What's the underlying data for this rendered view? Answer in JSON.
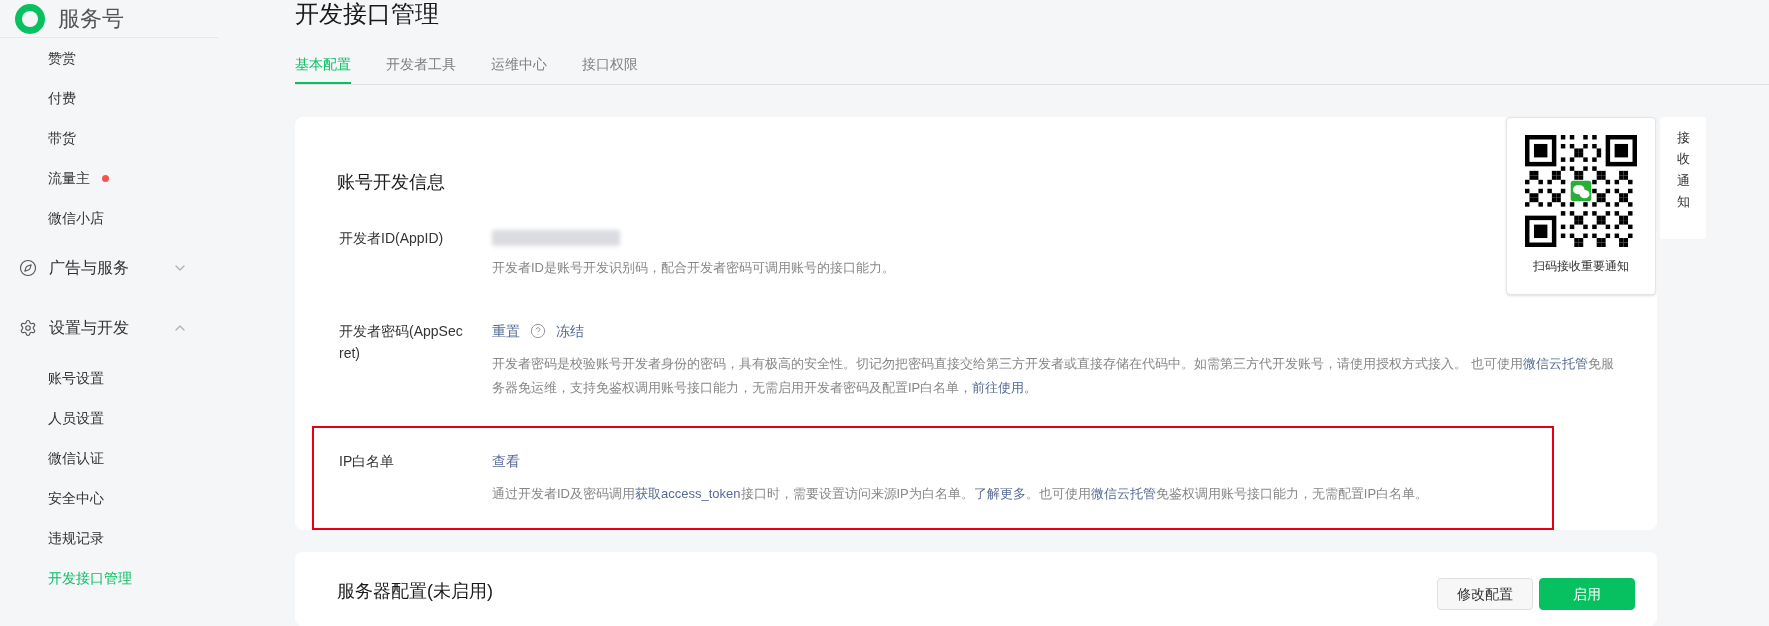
{
  "sidebar": {
    "brand": "服务号",
    "items": [
      {
        "kind": "item",
        "label": "赞赏",
        "selected": false,
        "dot": false
      },
      {
        "kind": "item",
        "label": "付费",
        "selected": false,
        "dot": false
      },
      {
        "kind": "item",
        "label": "带货",
        "selected": false,
        "dot": false
      },
      {
        "kind": "item",
        "label": "流量主",
        "selected": false,
        "dot": true
      },
      {
        "kind": "item",
        "label": "微信小店",
        "selected": false,
        "dot": false
      },
      {
        "kind": "group",
        "label": "广告与服务",
        "expanded": false
      },
      {
        "kind": "group",
        "label": "设置与开发",
        "expanded": true,
        "children": [
          {
            "label": "账号设置",
            "selected": false
          },
          {
            "label": "人员设置",
            "selected": false
          },
          {
            "label": "微信认证",
            "selected": false
          },
          {
            "label": "安全中心",
            "selected": false
          },
          {
            "label": "违规记录",
            "selected": false
          },
          {
            "label": "开发接口管理",
            "selected": true
          }
        ]
      }
    ]
  },
  "page_title": "开发接口管理",
  "tabs": [
    {
      "label": "基本配置",
      "selected": true
    },
    {
      "label": "开发者工具",
      "selected": false
    },
    {
      "label": "运维中心",
      "selected": false
    },
    {
      "label": "接口权限",
      "selected": false
    }
  ],
  "account_card": {
    "title": "账号开发信息",
    "rows": [
      {
        "label": "开发者ID(AppID)",
        "highlighted": false,
        "value_blurred": true,
        "actions": [],
        "description": [
          {
            "text": "开发者ID是账号开发识别码，配合开发者密码可调用账号的接口能力。",
            "link": false
          }
        ]
      },
      {
        "label": "开发者密码(AppSecret)",
        "highlighted": false,
        "value_blurred": false,
        "actions": [
          {
            "kind": "link",
            "label": "重置"
          },
          {
            "kind": "help"
          },
          {
            "kind": "link",
            "label": "冻结"
          }
        ],
        "description": [
          {
            "text": "开发者密码是校验账号开发者身份的密码，具有极高的安全性。切记勿把密码直接交给第三方开发者或直接存储在代码中。如需第三方代开发账号，请使用授权方式接入。 也可使用",
            "link": false
          },
          {
            "text": "微信云托管",
            "link": true
          },
          {
            "text": "免服务器免运维，支持免鉴权调用账号接口能力，无需启用开发者密码及配置IP白名单，",
            "link": false
          },
          {
            "text": "前往使用。",
            "link": true
          }
        ]
      },
      {
        "label": "IP白名单",
        "highlighted": true,
        "value_blurred": false,
        "actions": [
          {
            "kind": "link",
            "label": "查看"
          }
        ],
        "description": [
          {
            "text": "通过开发者ID及密码调用",
            "link": false
          },
          {
            "text": "获取access_token",
            "link": true
          },
          {
            "text": "接口时，需要设置访问来源IP为白名单。",
            "link": false
          },
          {
            "text": "了解更多",
            "link": true
          },
          {
            "text": "。也可使用",
            "link": false
          },
          {
            "text": "微信云托管",
            "link": true
          },
          {
            "text": "免鉴权调用账号接口能力，无需配置IP白名单。",
            "link": false
          }
        ]
      }
    ]
  },
  "qr_popup": {
    "caption": "扫码接收重要通知"
  },
  "side_tab": {
    "label": "接收通知"
  },
  "server_card": {
    "title": "服务器配置(未启用)",
    "buttons": [
      {
        "label": "修改配置",
        "kind": "secondary"
      },
      {
        "label": "启用",
        "kind": "primary"
      }
    ]
  }
}
